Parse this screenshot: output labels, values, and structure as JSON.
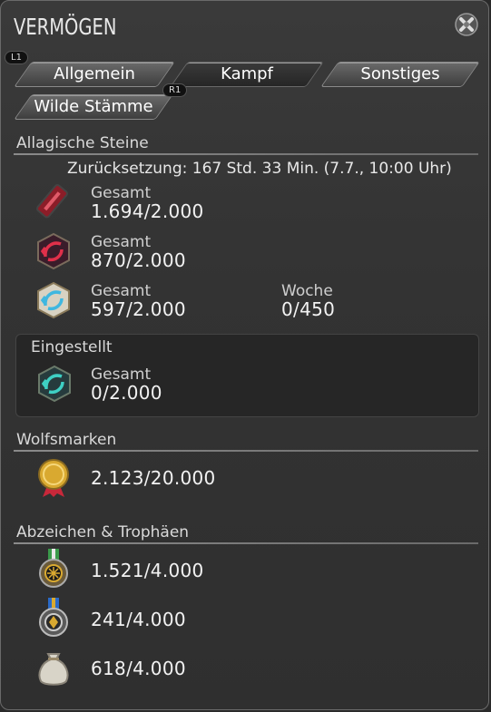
{
  "window": {
    "title": "VERMÖGEN"
  },
  "hints": {
    "left": "L1",
    "right": "R1"
  },
  "tabs": [
    {
      "label": "Allgemein"
    },
    {
      "label": "Kampf"
    },
    {
      "label": "Sonstiges"
    },
    {
      "label": "Wilde Stämme"
    }
  ],
  "allagan": {
    "header": "Allagische Steine",
    "reset": "Zurücksetzung: 167 Std. 33 Min. (7.7., 10:00 Uhr)",
    "items": [
      {
        "icon": "red-stone-tablet-icon",
        "total_label": "Gesamt",
        "total": "1.694/2.000"
      },
      {
        "icon": "red-allagan-stone-icon",
        "total_label": "Gesamt",
        "total": "870/2.000"
      },
      {
        "icon": "blue-allagan-stone-icon",
        "total_label": "Gesamt",
        "total": "597/2.000",
        "week_label": "Woche",
        "week": "0/450"
      }
    ],
    "discontinued": {
      "header": "Eingestellt",
      "icon": "teal-allagan-stone-icon",
      "total_label": "Gesamt",
      "total": "0/2.000"
    }
  },
  "wolf": {
    "header": "Wolfsmarken",
    "icon": "gold-wolf-mark-icon",
    "value": "2.123/20.000"
  },
  "trophies": {
    "header": "Abzeichen & Trophäen",
    "items": [
      {
        "icon": "green-ribbon-medal-icon",
        "value": "1.521/4.000"
      },
      {
        "icon": "blue-ribbon-medal-icon",
        "value": "241/4.000"
      },
      {
        "icon": "sack-icon",
        "value": "618/4.000"
      }
    ]
  },
  "colors": {
    "accent_blue": "#3fb7e0",
    "accent_red": "#c8283a",
    "gold": "#d9a930"
  }
}
